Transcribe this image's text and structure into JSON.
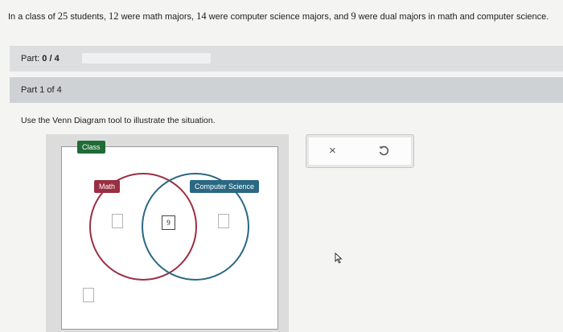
{
  "problem": {
    "p1": "In a class of ",
    "n_students": "25",
    "p2": " students, ",
    "n_math": "12",
    "p3": " were math majors, ",
    "n_cs": "14",
    "p4": " were computer science majors, and ",
    "n_dual": "9",
    "p5": " were dual majors in math and computer science."
  },
  "part_bar": {
    "label_prefix": "Part: ",
    "label_value": "0 / 4",
    "progress_fraction": 0
  },
  "part_header": {
    "title": "Part 1 of 4"
  },
  "instruction": "Use the Venn Diagram tool to illustrate the situation.",
  "venn": {
    "universe_label": "Class",
    "set_a_label": "Math",
    "set_b_label": "Computer Science",
    "only_a_value": "",
    "intersection_value": "9",
    "only_b_value": "",
    "outside_value": "",
    "colors": {
      "universe": "#1f6b35",
      "set_a": "#9a2f42",
      "set_b": "#2a6883"
    }
  },
  "tools": {
    "clear_icon": "close-icon",
    "reset_icon": "undo-icon",
    "clear_glyph": "×"
  }
}
